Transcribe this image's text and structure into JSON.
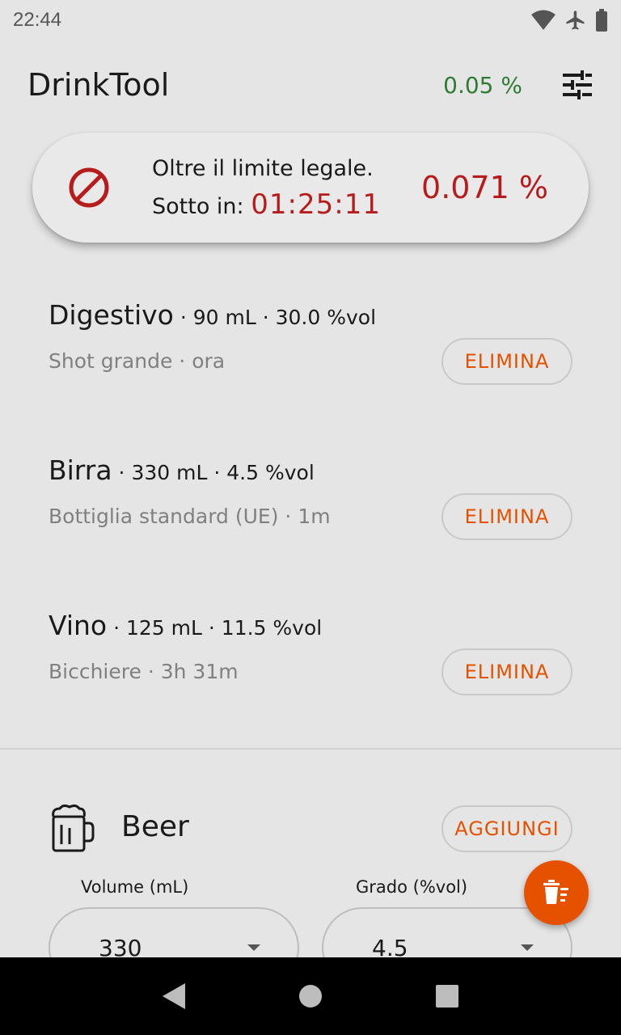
{
  "status_bar": {
    "time": "22:44",
    "icons": [
      "wifi-icon",
      "airplane-icon",
      "battery-icon"
    ]
  },
  "app_bar": {
    "title": "DrinkTool",
    "current_bac": "0.05 %",
    "settings_icon": "tune-icon"
  },
  "alert": {
    "icon": "ban-icon",
    "message": "Oltre il limite legale.",
    "countdown_label": "Sotto in:",
    "countdown_value": "01:25:11",
    "bac_value": "0.071 %",
    "color": "#b71c1c"
  },
  "drinks": [
    {
      "name": "Digestivo",
      "volume": "90",
      "unit": "mL",
      "abv": "30.0 %vol",
      "size_label": "Shot grande",
      "time_ago": "ora",
      "delete_label": "ELIMINA"
    },
    {
      "name": "Birra",
      "volume": "330",
      "unit": "mL",
      "abv": "4.5 %vol",
      "size_label": "Bottiglia standard (UE)",
      "time_ago": "1m",
      "delete_label": "ELIMINA"
    },
    {
      "name": "Vino",
      "volume": "125",
      "unit": "mL",
      "abv": "11.5 %vol",
      "size_label": "Bicchiere",
      "time_ago": "3h 31m",
      "delete_label": "ELIMINA"
    }
  ],
  "add_drink": {
    "icon": "beer-mug-icon",
    "type_name": "Beer",
    "add_label": "AGGIUNGI",
    "volume_label": "Volume (mL)",
    "volume_value": "330",
    "abv_label": "Grado (%vol)",
    "abv_value": "4.5"
  },
  "fab": {
    "icon": "clear-list-icon"
  },
  "nav": {
    "icons": [
      "back-icon",
      "home-icon",
      "recents-icon"
    ]
  },
  "colors": {
    "accent": "#e65100",
    "danger": "#b71c1c",
    "ok": "#2e7d32",
    "background": "#e5e5e5"
  }
}
